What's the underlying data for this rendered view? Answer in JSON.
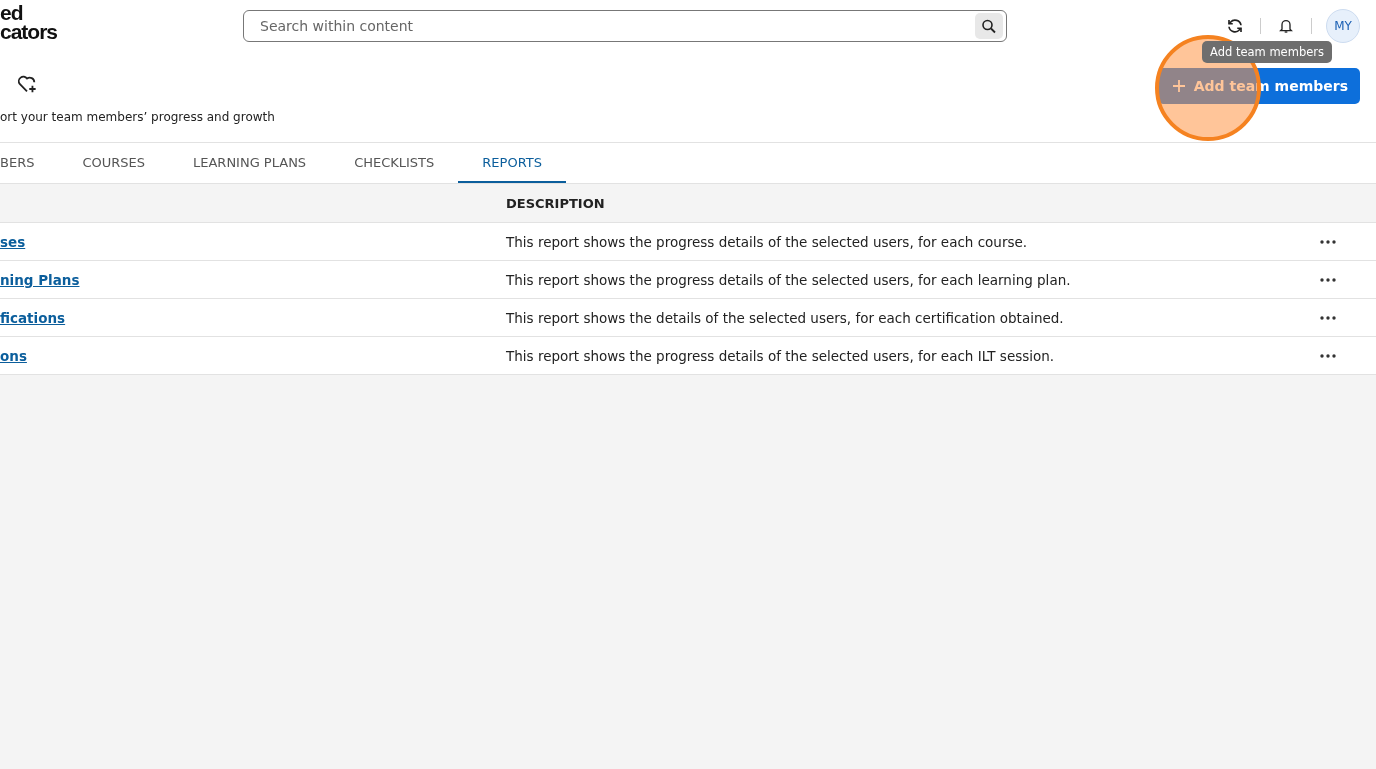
{
  "logo": {
    "line_1": "ed",
    "line_2": "cators"
  },
  "search": {
    "placeholder": "Search within content"
  },
  "avatar": {
    "initials": "MY"
  },
  "tooltip": "Add team members",
  "page": {
    "subtitle": "ort your team members’ progress and growth",
    "add_button": "Add team members"
  },
  "tabs": [
    {
      "label": "BERS",
      "selected": false
    },
    {
      "label": "COURSES",
      "selected": false
    },
    {
      "label": "LEARNING PLANS",
      "selected": false
    },
    {
      "label": "CHECKLISTS",
      "selected": false
    },
    {
      "label": "REPORTS",
      "selected": true
    }
  ],
  "table": {
    "columns": [
      "DESCRIPTION"
    ],
    "rows": [
      {
        "name": "ses",
        "description": "This report shows the progress details of the selected users, for each course."
      },
      {
        "name": "ning Plans",
        "description": "This report shows the progress details of the selected users, for each learning plan."
      },
      {
        "name": "fications",
        "description": "This report shows the details of the selected users, for each certification obtained."
      },
      {
        "name": "ons",
        "description": "This report shows the progress details of the selected users, for each ILT session."
      }
    ]
  }
}
